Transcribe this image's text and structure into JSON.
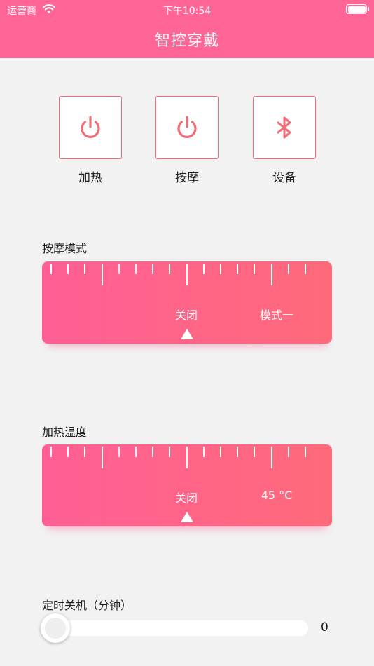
{
  "status_bar": {
    "carrier": "运营商",
    "time": "下午10:54"
  },
  "nav": {
    "title": "智控穿戴"
  },
  "controls": [
    {
      "label": "加热",
      "icon": "power-icon"
    },
    {
      "label": "按摩",
      "icon": "power-icon"
    },
    {
      "label": "设备",
      "icon": "bluetooth-icon"
    }
  ],
  "massage_mode": {
    "title": "按摩模式",
    "current": "关闭",
    "next": "模式一"
  },
  "heating_temp": {
    "title": "加热温度",
    "current": "关闭",
    "next": "45 °C"
  },
  "timer": {
    "title": "定时关机（分钟）",
    "value": "0"
  },
  "colors": {
    "brand": "#ff6595",
    "accent": "#f06c76"
  }
}
